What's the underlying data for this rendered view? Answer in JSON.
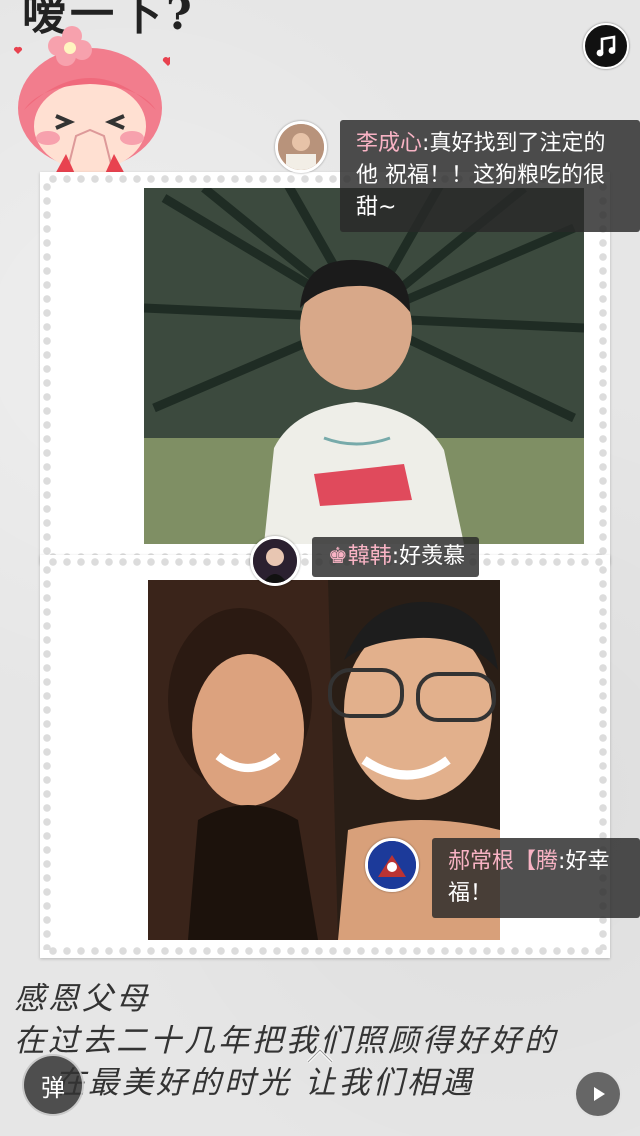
{
  "header": {
    "text": "嗳一下?"
  },
  "music_button": {
    "icon": "music-note-icon"
  },
  "comments": [
    {
      "name": "李成心",
      "text": "真好找到了注定的他 祝福！！这狗粮吃的很甜~"
    },
    {
      "name": "♚韓韩",
      "text": "好羡慕"
    },
    {
      "name": "郝常根【腾",
      "text": "好幸福！"
    }
  ],
  "caption": {
    "line1": "感恩父母",
    "line2": "在过去二十几年把我们照顾得好好的",
    "line3": "在最美好的时光 让我们相遇"
  },
  "controls": {
    "danmu_label": "弹",
    "play_icon": "play-icon",
    "up_icon": "chevron-up-icon"
  },
  "colors": {
    "comment_name": "#f8b3c4",
    "comment_bg": "#282828"
  }
}
